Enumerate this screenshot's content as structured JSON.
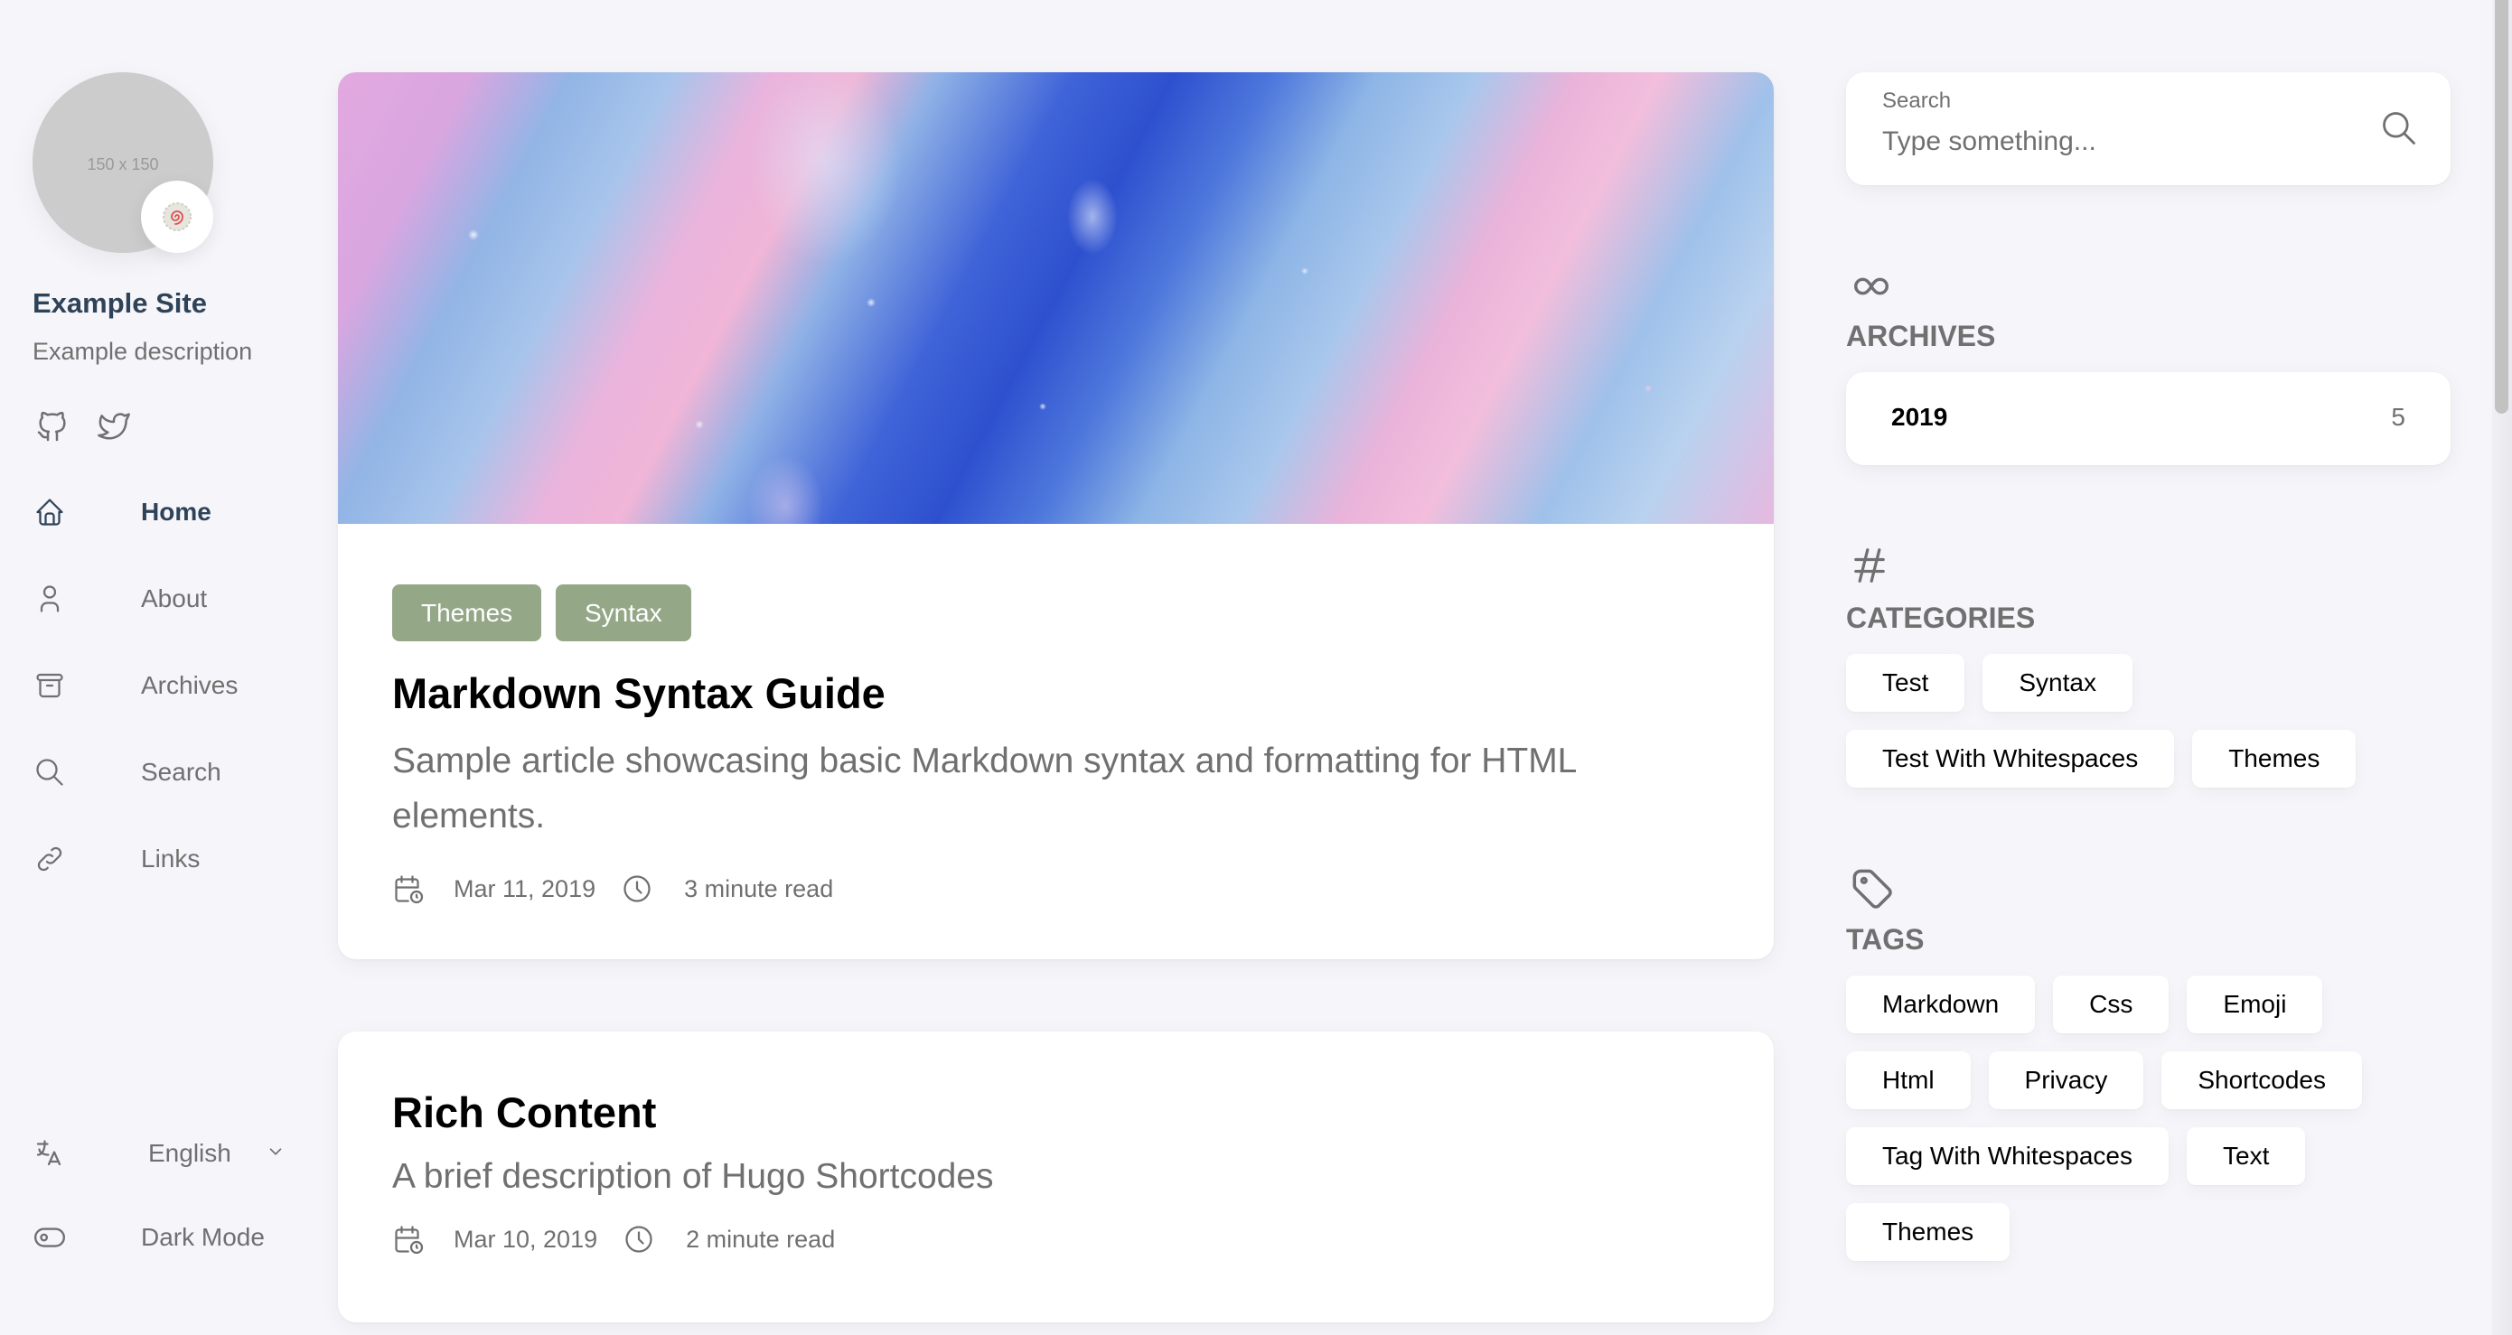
{
  "sidebar": {
    "avatar_placeholder": "150 x 150",
    "site_title": "Example Site",
    "site_description": "Example description",
    "social": [
      {
        "name": "github",
        "icon": "github-icon"
      },
      {
        "name": "twitter",
        "icon": "twitter-icon"
      }
    ],
    "nav": [
      {
        "label": "Home",
        "icon": "home-icon",
        "active": true
      },
      {
        "label": "About",
        "icon": "user-icon",
        "active": false
      },
      {
        "label": "Archives",
        "icon": "archive-icon",
        "active": false
      },
      {
        "label": "Search",
        "icon": "search-icon",
        "active": false
      },
      {
        "label": "Links",
        "icon": "link-icon",
        "active": false
      }
    ],
    "language": {
      "label": "English",
      "icon": "language-icon"
    },
    "dark_mode": {
      "label": "Dark Mode",
      "icon": "toggle-icon"
    }
  },
  "posts": [
    {
      "categories": [
        "Themes",
        "Syntax"
      ],
      "title": "Markdown Syntax Guide",
      "description": "Sample article showcasing basic Markdown syntax and formatting for HTML elements.",
      "date": "Mar 11, 2019",
      "read_time": "3 minute read",
      "has_image": true
    },
    {
      "categories": [],
      "title": "Rich Content",
      "description": "A brief description of Hugo Shortcodes",
      "date": "Mar 10, 2019",
      "read_time": "2 minute read",
      "has_image": false
    }
  ],
  "right": {
    "search": {
      "label": "Search",
      "placeholder": "Type something...",
      "value": ""
    },
    "archives": {
      "title": "ARCHIVES",
      "items": [
        {
          "year": "2019",
          "count": "5"
        }
      ]
    },
    "categories": {
      "title": "CATEGORIES",
      "items": [
        "Test",
        "Syntax",
        "Test With Whitespaces",
        "Themes"
      ]
    },
    "tags": {
      "title": "TAGS",
      "items": [
        "Markdown",
        "Css",
        "Emoji",
        "Html",
        "Privacy",
        "Shortcodes",
        "Tag With Whitespaces",
        "Text",
        "Themes"
      ]
    }
  },
  "colors": {
    "background": "#f5f5fa",
    "accent_tag": "#94a787",
    "title_dark": "#2f4358",
    "text_muted": "#707070"
  }
}
